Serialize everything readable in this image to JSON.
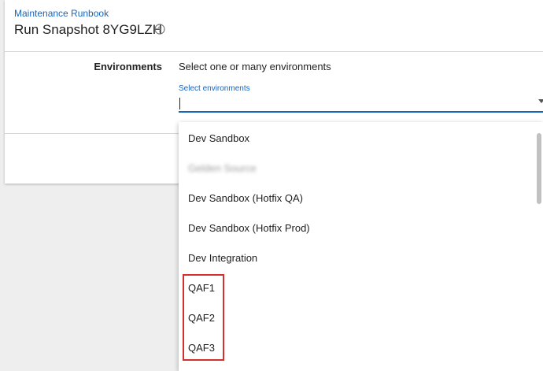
{
  "header": {
    "breadcrumb": "Maintenance Runbook",
    "title": "Run Snapshot 8YG9LZH",
    "help_icon": "help-circle-icon"
  },
  "form": {
    "field_label": "Environments",
    "field_description": "Select one or many environments",
    "select_label": "Select environments",
    "select_value": ""
  },
  "dropdown": {
    "options": [
      "Dev Sandbox",
      "Gelden Source",
      "Dev Sandbox (Hotfix QA)",
      "Dev Sandbox (Hotfix Prod)",
      "Dev Integration",
      "QAF1",
      "QAF2",
      "QAF3"
    ]
  },
  "colors": {
    "accent": "#1565c0",
    "highlight": "#d32f2f"
  }
}
